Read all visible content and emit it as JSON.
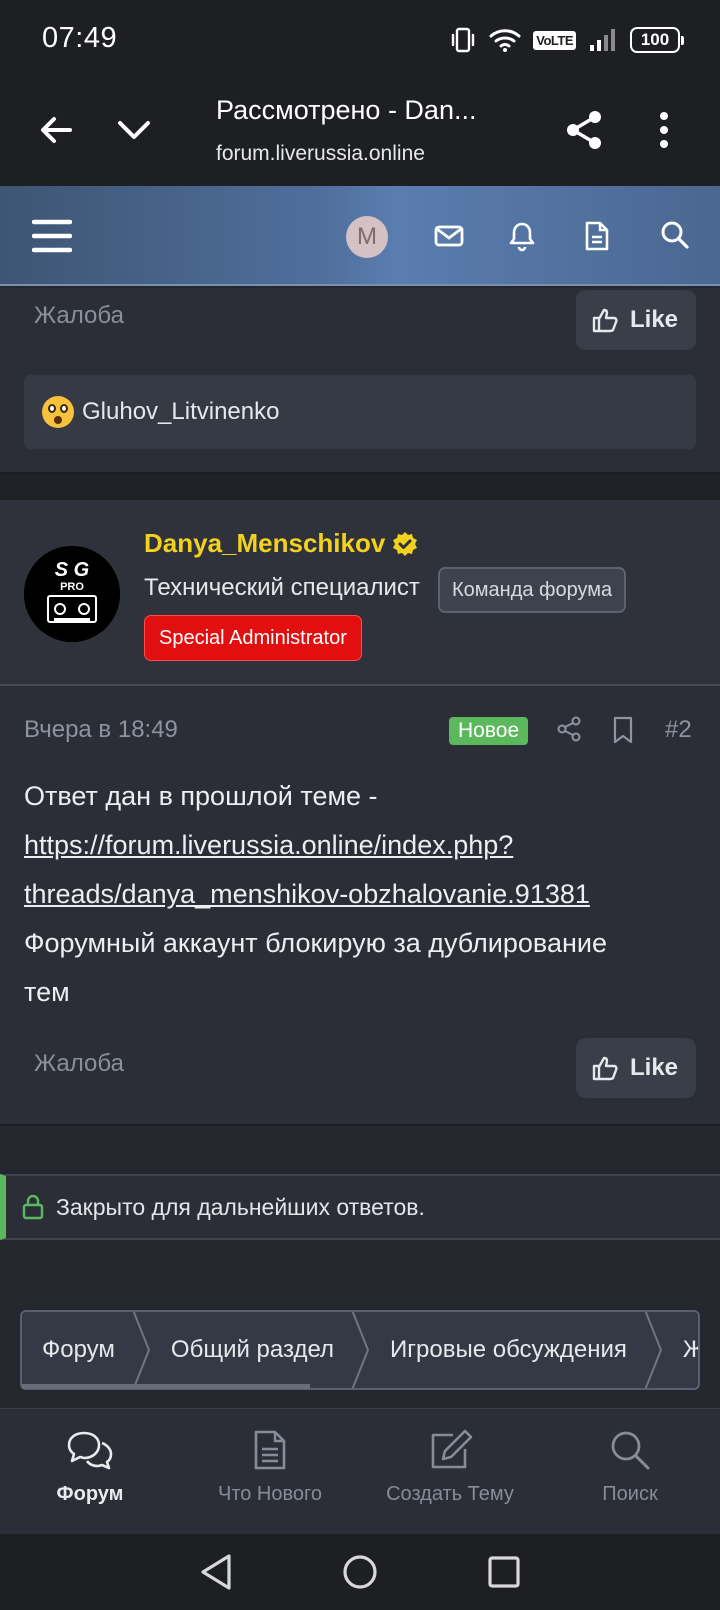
{
  "status_bar": {
    "time": "07:49",
    "volte": "VoLTE",
    "battery": "100"
  },
  "browser": {
    "title": "Рассмотрено - Dan...",
    "url": "forum.liverussia.online"
  },
  "forum_header": {
    "avatar_letter": "M"
  },
  "prev_post": {
    "report_label": "Жалоба",
    "like_label": "Like",
    "reaction_user": "Gluhov_Litvinenko"
  },
  "post": {
    "username": "Danya_Menschikov",
    "user_title": "Технический специалист",
    "team_badge": "Команда форума",
    "role_badge": "Special Administrator",
    "date": "Вчера в 18:49",
    "new_badge": "Новое",
    "number": "#2",
    "body_line1": "Ответ дан в прошлой теме -",
    "link_line1": "https://forum.liverussia.online/index.php?",
    "link_line2": "threads/danya_menshikov-obzhalovanie.91381",
    "body_line3": "Форумный аккаунт блокирую за дублирование",
    "body_line4": "тем",
    "report_label": "Жалоба",
    "like_label": "Like"
  },
  "locked_notice": "Закрыто для дальнейших ответов.",
  "breadcrumb": [
    {
      "label": "Форум"
    },
    {
      "label": "Общий раздел"
    },
    {
      "label": "Игровые обсуждения"
    },
    {
      "label": "Жа"
    }
  ],
  "bottom_nav": {
    "forum": "Форум",
    "whats_new": "Что Нового",
    "create_thread": "Создать Тему",
    "search": "Поиск"
  },
  "colors": {
    "username": "#f2d21f",
    "new_badge": "#5cb85c",
    "admin_badge": "#e10f0f"
  }
}
